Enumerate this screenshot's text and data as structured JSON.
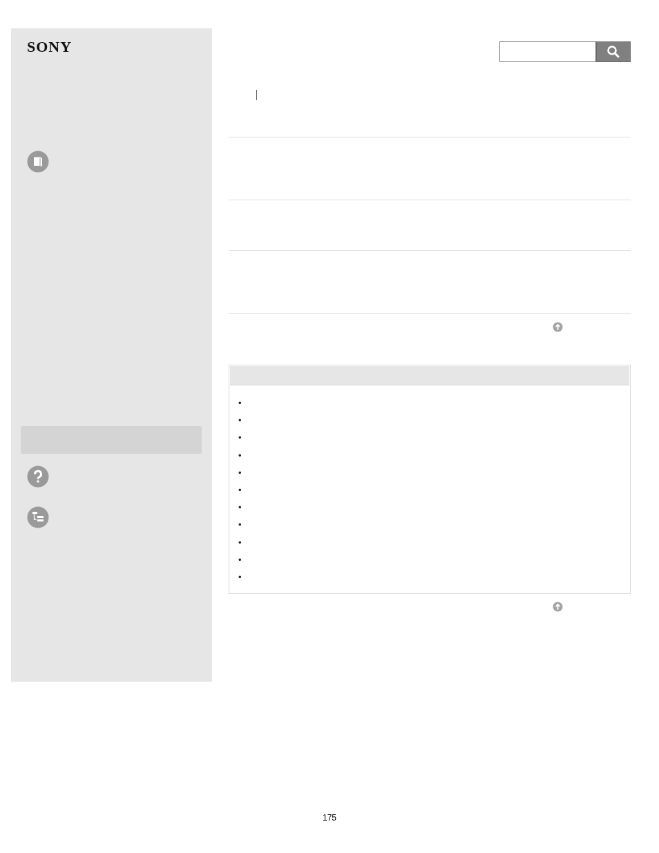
{
  "logo": "SONY",
  "content_list": {
    "bullets": [
      "•",
      "•",
      "•",
      "•",
      "•",
      "•",
      "•",
      "•",
      "•",
      "•",
      "•"
    ]
  },
  "page_number": "175"
}
